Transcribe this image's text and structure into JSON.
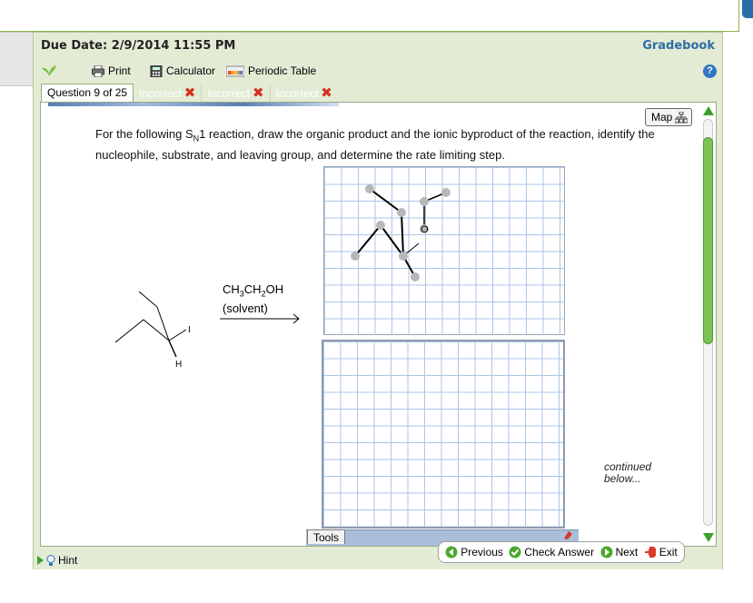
{
  "header": {
    "due_date": "Due Date: 2/9/2014 11:55 PM",
    "gradebook": "Gradebook"
  },
  "toolbar": {
    "print": "Print",
    "calculator": "Calculator",
    "periodic_table": "Periodic Table",
    "help": "?"
  },
  "tabs": {
    "question": "Question 9 of 25",
    "attempts": [
      "Incorrect",
      "Incorrect",
      "Incorrect"
    ]
  },
  "question": {
    "text_before": "For the following S",
    "subscript": "N",
    "text_after": "1 reaction, draw the organic product and the ionic byproduct of the reaction, identify the nucleophile, substrate, and leaving group, and determine the rate limiting step."
  },
  "map": {
    "label": "Map"
  },
  "reactant": {
    "atom_i": "I",
    "atom_h": "H"
  },
  "reagent": {
    "formula_parts": [
      "CH",
      "3",
      "CH",
      "2",
      "OH"
    ],
    "solvent": "(solvent)"
  },
  "drawing": {
    "oxygen_label": "O"
  },
  "tools": {
    "label": "Tools"
  },
  "continued": {
    "line1": "continued",
    "line2": "below..."
  },
  "footer": {
    "hint": "Hint",
    "previous": "Previous",
    "check_answer": "Check Answer",
    "next": "Next",
    "exit": "Exit"
  },
  "colors": {
    "accent_green": "#8fb24a",
    "link_blue": "#2d6ea8",
    "error_red": "#d63020"
  }
}
